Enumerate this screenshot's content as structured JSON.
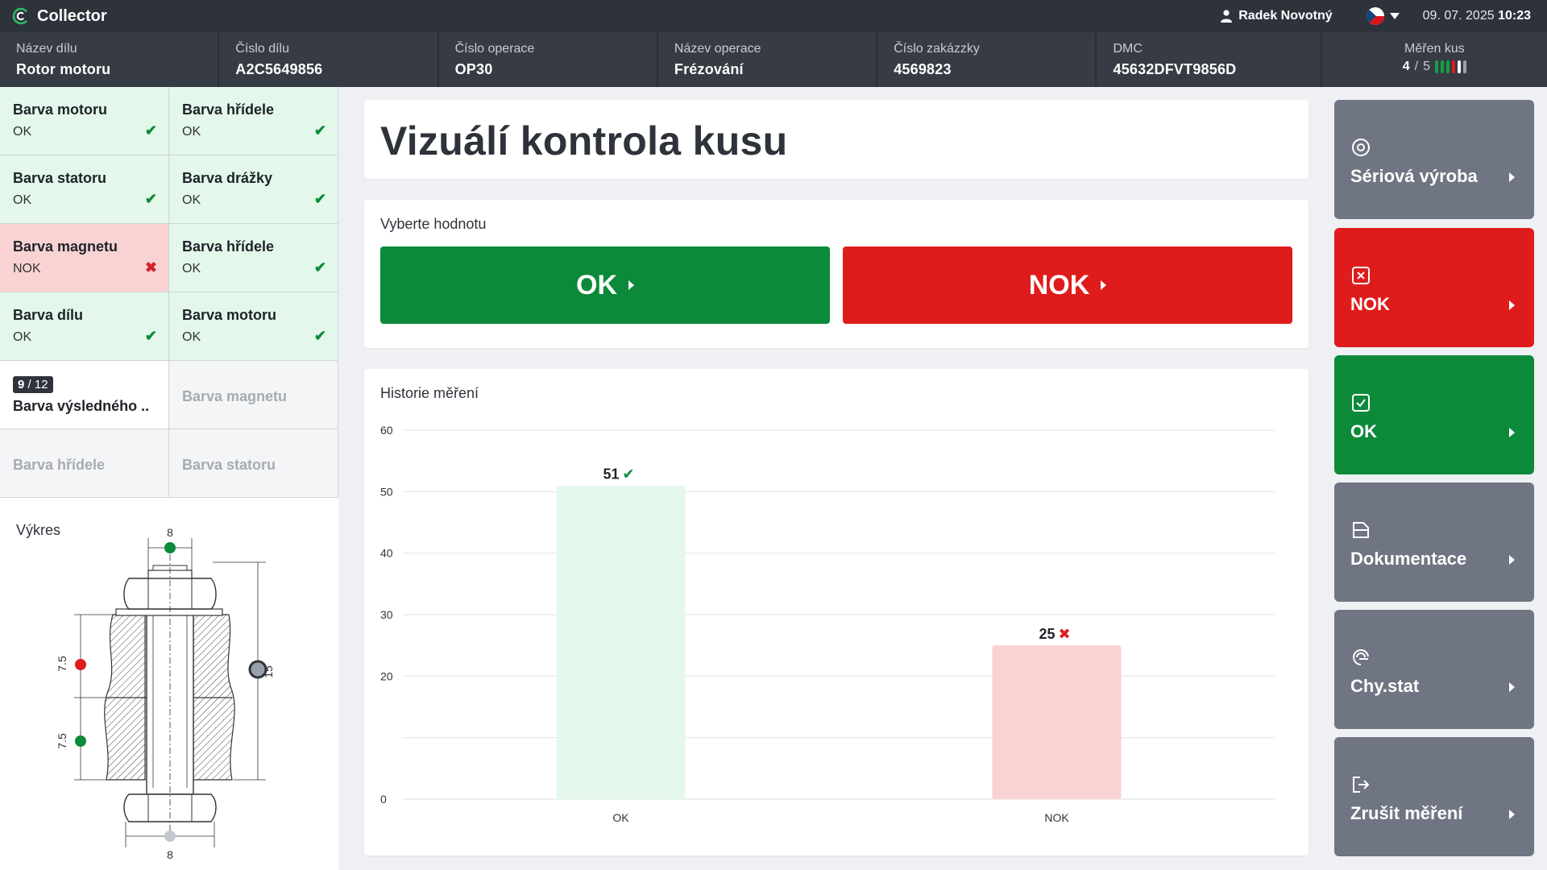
{
  "app": {
    "title": "Collector"
  },
  "header": {
    "user": "Radek Novotný",
    "date": "09. 07. 2025",
    "time": "10:23"
  },
  "info": {
    "part_name": {
      "label": "Název dílu",
      "value": "Rotor motoru"
    },
    "part_number": {
      "label": "Číslo dílu",
      "value": "A2C5649856"
    },
    "op_number": {
      "label": "Číslo operace",
      "value": "OP30"
    },
    "op_name": {
      "label": "Název operace",
      "value": "Frézování"
    },
    "order_number": {
      "label": "Číslo zakázzky",
      "value": "4569823"
    },
    "dmc": {
      "label": "DMC",
      "value": "45632DFVT9856D"
    },
    "measured": {
      "label": "Měřen kus",
      "current": "4",
      "sep": "/",
      "total": "5"
    }
  },
  "checks": [
    {
      "title": "Barva motoru",
      "status": "OK",
      "result": "ok"
    },
    {
      "title": "Barva hřídele",
      "status": "OK",
      "result": "ok"
    },
    {
      "title": "Barva statoru",
      "status": "OK",
      "result": "ok"
    },
    {
      "title": "Barva drážky",
      "status": "OK",
      "result": "ok"
    },
    {
      "title": "Barva magnetu",
      "status": "NOK",
      "result": "nok"
    },
    {
      "title": "Barva hřídele",
      "status": "OK",
      "result": "ok"
    },
    {
      "title": "Barva dílu",
      "status": "OK",
      "result": "ok"
    },
    {
      "title": "Barva motoru",
      "status": "OK",
      "result": "ok"
    }
  ],
  "active_check": {
    "index": "9",
    "sep": "/",
    "total": "12",
    "title": "Barva výsledného .."
  },
  "pending_checks": [
    "Barva magnetu",
    "Barva hřídele",
    "Barva statoru"
  ],
  "drawing": {
    "title": "Výkres",
    "dims": {
      "top": "8",
      "bottom": "8",
      "right": "15",
      "left_upper": "7.5",
      "left_lower": "7.5"
    }
  },
  "main": {
    "title": "Vizuálí kontrola kusu",
    "select_label": "Vyberte hodnotu",
    "ok_label": "OK",
    "nok_label": "NOK",
    "history_label": "Historie měření"
  },
  "chart_data": {
    "type": "bar",
    "categories": [
      "OK",
      "NOK"
    ],
    "values": [
      51,
      25
    ],
    "ylim": [
      0,
      60
    ],
    "yticks": [
      0,
      10,
      20,
      30,
      40,
      50,
      60
    ],
    "ytick_labels": [
      "0",
      "20",
      "30",
      "40",
      "50",
      "60"
    ],
    "grid": true,
    "colors": [
      "#e3f8ea",
      "#f9d3d3"
    ]
  },
  "side_menu": [
    {
      "label": "Sériová výroba",
      "icon": "target-icon",
      "color": "gray"
    },
    {
      "label": "NOK",
      "icon": "x-box-icon",
      "color": "red"
    },
    {
      "label": "OK",
      "icon": "check-box-icon",
      "color": "green"
    },
    {
      "label": "Dokumentace",
      "icon": "document-icon",
      "color": "gray"
    },
    {
      "label": "Chy.stat",
      "icon": "stats-icon",
      "color": "gray"
    },
    {
      "label": "Zrušit měření",
      "icon": "exit-icon",
      "color": "gray"
    }
  ],
  "colors": {
    "ok": "#0c8a3a",
    "nok": "#df1c1c",
    "gray": "#6f7582",
    "dark": "#2e333b"
  }
}
